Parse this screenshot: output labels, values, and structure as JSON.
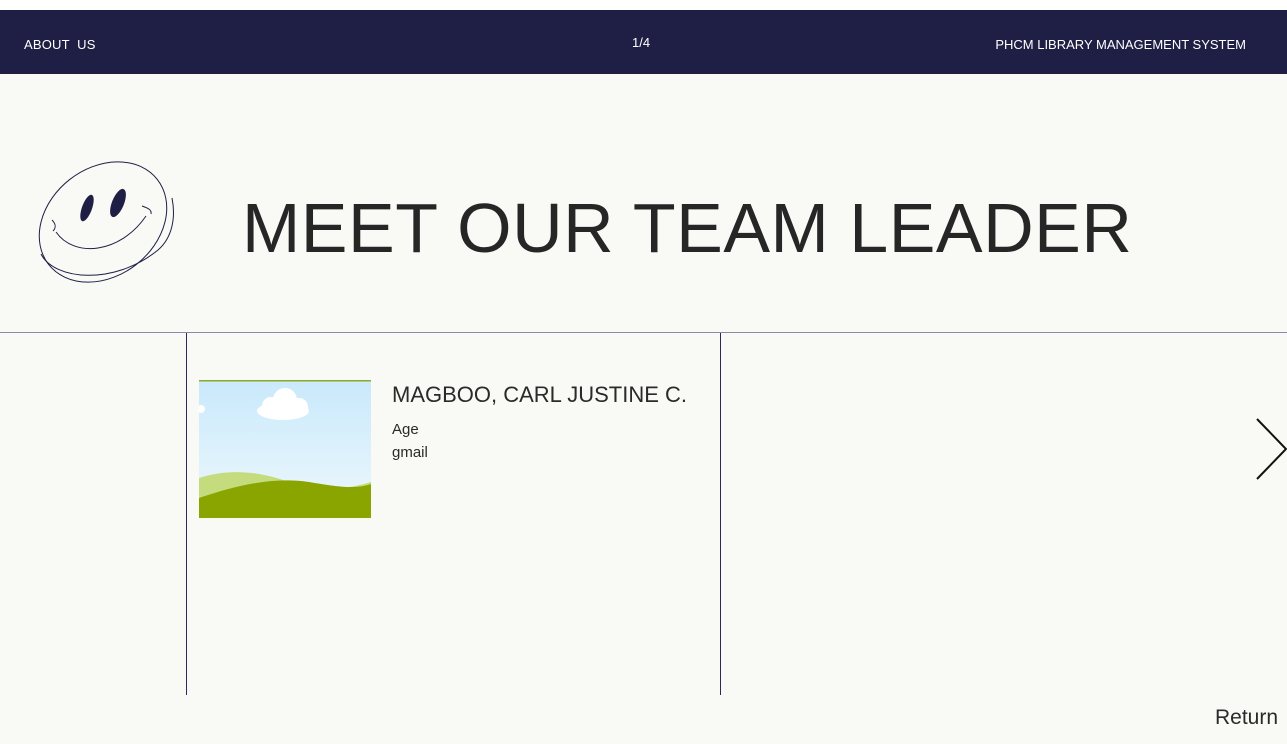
{
  "header": {
    "left_label": "ABOUT  US",
    "page_indicator": "1/4",
    "system_title": "PHCM LIBRARY MANAGEMENT SYSTEM"
  },
  "hero": {
    "title": "MEET OUR TEAM LEADER",
    "icon": "smiley-face-icon"
  },
  "member": {
    "name": "MAGBOO, CARL JUSTINE C.",
    "age_label": "Age",
    "email_label": "gmail",
    "photo_icon": "landscape-placeholder-icon"
  },
  "nav": {
    "next_icon": "chevron-right-icon",
    "return_label": "Return"
  },
  "colors": {
    "header_bg": "#1f1f45",
    "page_bg": "#f9f9f6",
    "text": "#262626",
    "divider": "#2a2a5a"
  }
}
